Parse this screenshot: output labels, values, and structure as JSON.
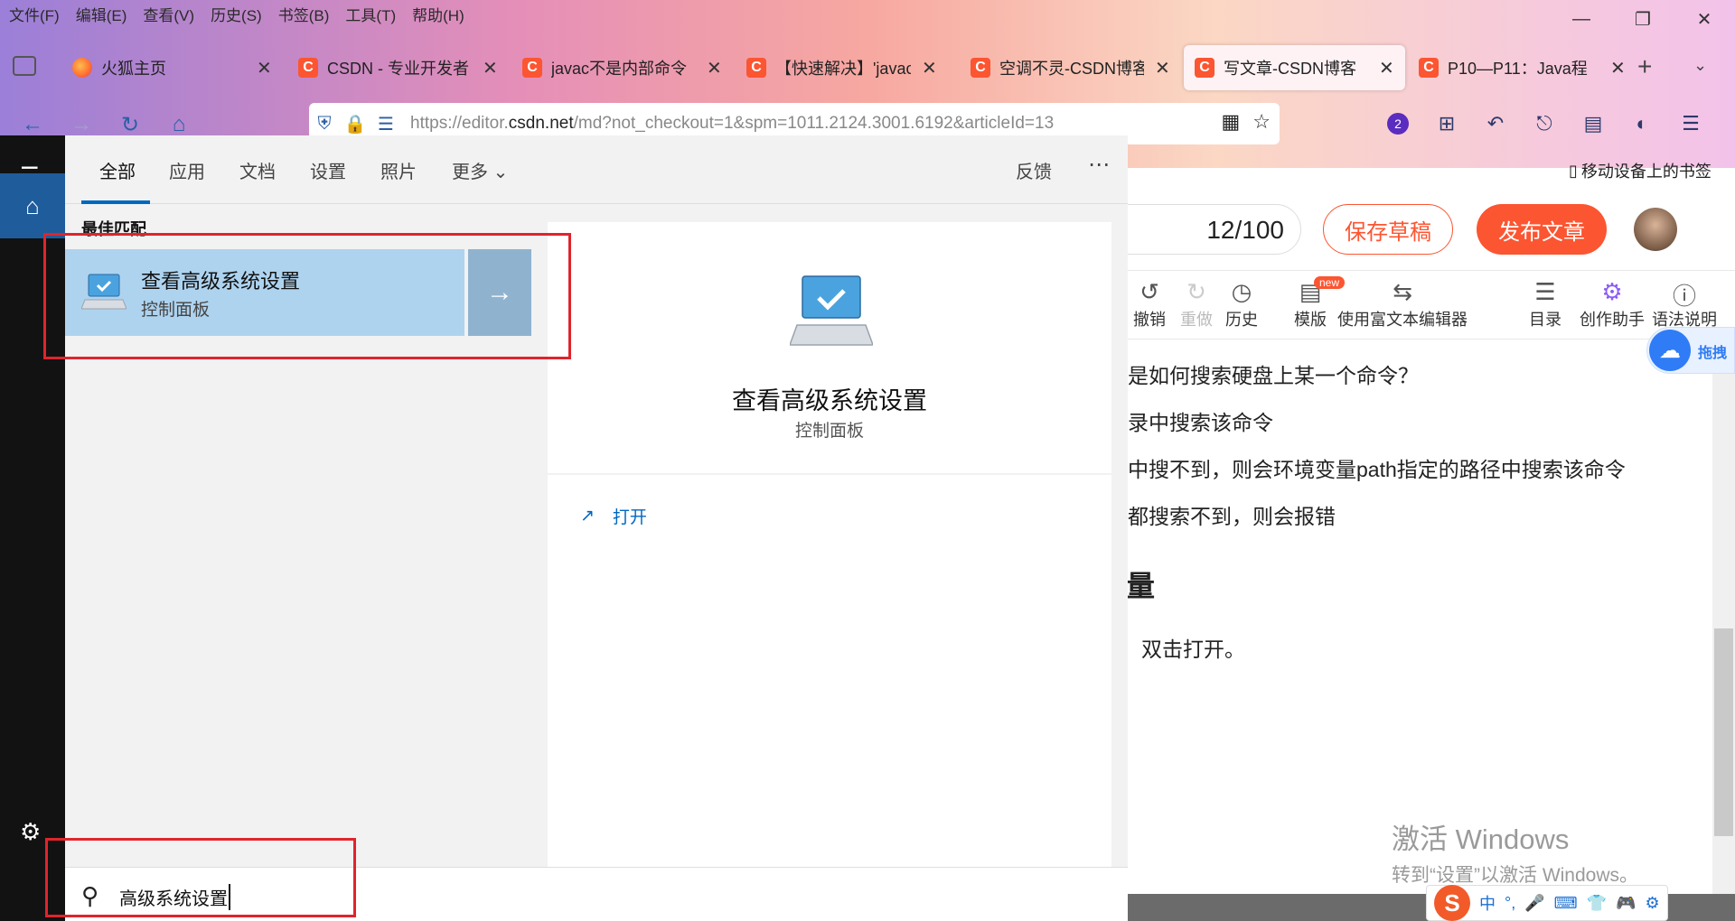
{
  "browser": {
    "menu": [
      "文件(F)",
      "编辑(E)",
      "查看(V)",
      "历史(S)",
      "书签(B)",
      "工具(T)",
      "帮助(H)"
    ],
    "tabs": [
      {
        "label": "火狐主页",
        "fav": "firefox"
      },
      {
        "label": "CSDN - 专业开发者",
        "fav": "C"
      },
      {
        "label": "javac不是内部命令",
        "fav": "C"
      },
      {
        "label": "【快速解决】'javac",
        "fav": "C"
      },
      {
        "label": "空调不灵-CSDN博客",
        "fav": "C"
      },
      {
        "label": "写文章-CSDN博客",
        "fav": "C",
        "active": true
      },
      {
        "label": "P10—P11：Java程",
        "fav": "C"
      }
    ],
    "url_prefix": "https://editor.",
    "url_domain": "csdn.net",
    "url_rest": "/md?not_checkout=1&spm=1011.2124.3001.6192&articleId=13",
    "extension_badge": "2",
    "mobile_bookmarks": "移动设备上的书签"
  },
  "editor": {
    "counter": "12/100",
    "save_draft": "保存草稿",
    "publish": "发布文章",
    "tools": [
      {
        "label": "撤销",
        "icon": "undo-icon"
      },
      {
        "label": "重做",
        "icon": "redo-icon"
      },
      {
        "label": "历史",
        "icon": "history-icon"
      },
      {
        "label": "模版",
        "icon": "template-icon"
      },
      {
        "label": "使用富文本编辑器",
        "icon": "switch-editor-icon"
      },
      {
        "label": "目录",
        "icon": "toc-icon"
      },
      {
        "label": "创作助手",
        "icon": "robot-icon"
      },
      {
        "label": "语法说明",
        "icon": "help-icon"
      }
    ],
    "new_badge": "new",
    "content_lines": [
      "是如何搜索硬盘上某一个命令？",
      "录中搜索该命令",
      "中搜不到，则会环境变量path指定的路径中搜索该命令",
      "都搜索不到，则会报错"
    ],
    "heading_fragment": "量",
    "paragraph_fragment": "，双击打开。",
    "side_float_text": "拖拽"
  },
  "watermark": {
    "line1": "激活 Windows",
    "line2": "转到“设置”以激活 Windows。"
  },
  "ime": {
    "items": [
      "中",
      "°,",
      "🎤",
      "⌨",
      "👕",
      "🎮",
      "⚙"
    ]
  },
  "search": {
    "tabs": [
      "全部",
      "应用",
      "文档",
      "设置",
      "照片",
      "更多"
    ],
    "feedback": "反馈",
    "best_match_label": "最佳匹配",
    "result_title": "查看高级系统设置",
    "result_sub": "控制面板",
    "detail_title": "查看高级系统设置",
    "detail_sub": "控制面板",
    "open_label": "打开",
    "query": "高级系统设置"
  }
}
